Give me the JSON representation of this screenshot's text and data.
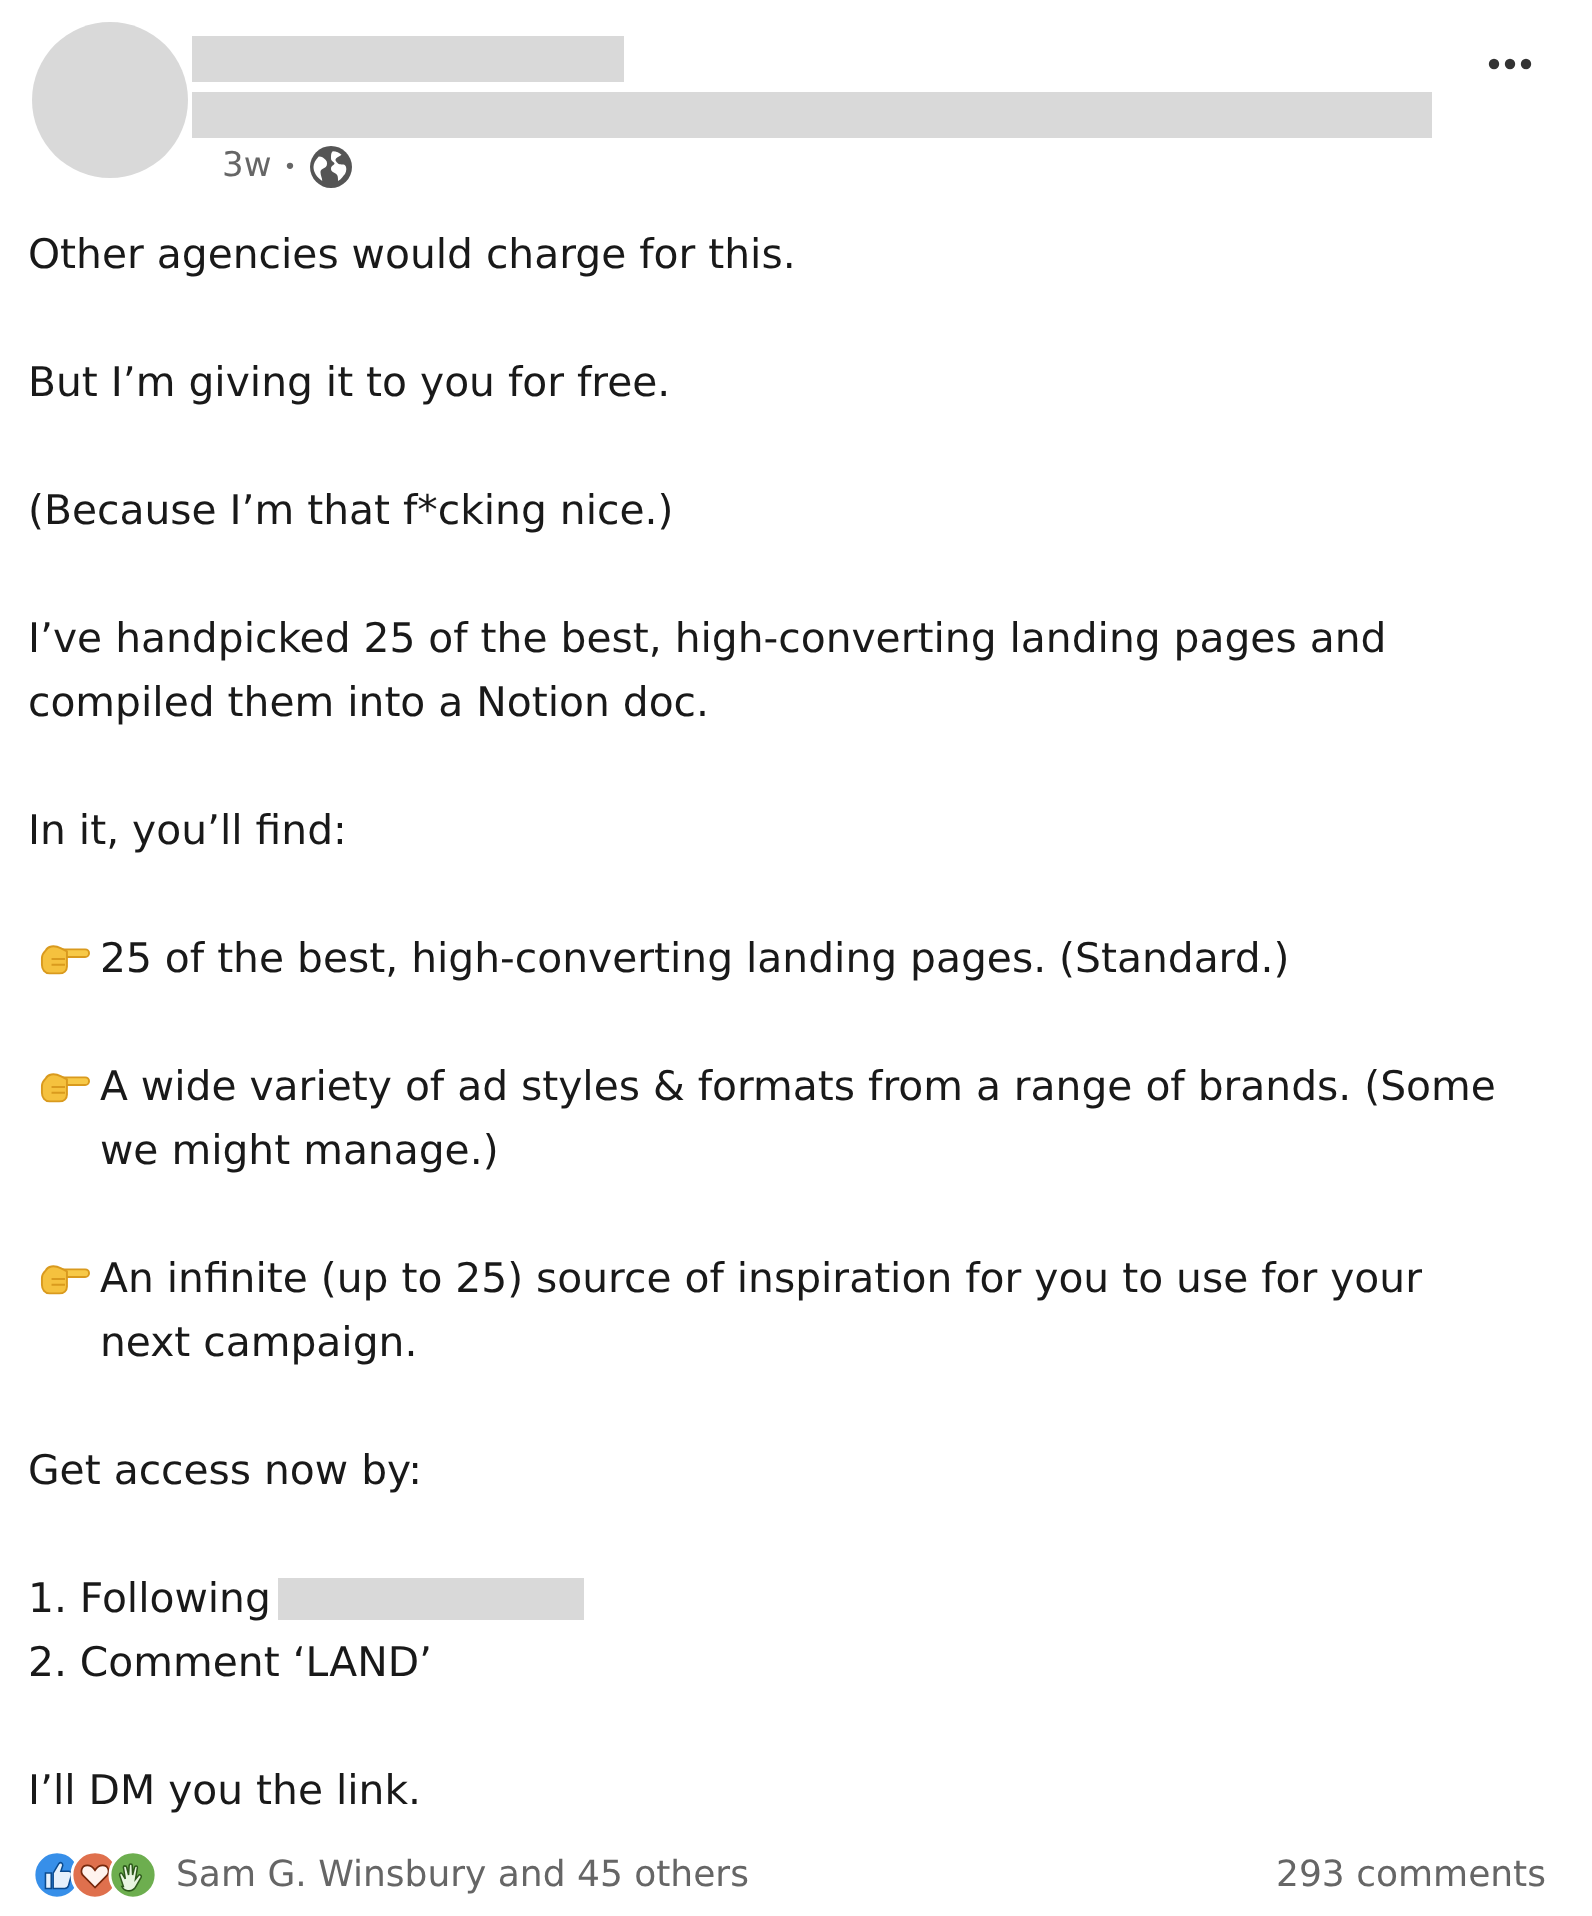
{
  "author": {
    "name_redacted": true,
    "headline_redacted": true
  },
  "post": {
    "time": "3w",
    "separator": "•"
  },
  "body": [
    {
      "kind": "text",
      "text": "Other agencies would charge for this."
    },
    {
      "kind": "text",
      "text": "But I’m giving it to you for free."
    },
    {
      "kind": "text",
      "text": "(Because I’m that f*cking nice.)"
    },
    {
      "kind": "text",
      "text": "I’ve handpicked 25 of the best, high-converting landing pages and compiled them into a Notion doc."
    },
    {
      "kind": "text",
      "text": "In it, you’ll find:"
    },
    {
      "kind": "point",
      "text": "25 of the best, high-converting landing pages. (Standard.)"
    },
    {
      "kind": "point",
      "text": "A wide variety of ad styles & formats from a range of brands. (Some we might manage.)"
    },
    {
      "kind": "point",
      "text": "An infinite (up to 25) source of inspiration for you to use for your next campaign."
    },
    {
      "kind": "text",
      "text": "Get access now by:"
    },
    {
      "kind": "list",
      "lines": [
        {
          "text": "1. Following",
          "redacted": true
        },
        {
          "text": "2. Comment ‘LAND’",
          "redacted": false
        }
      ]
    },
    {
      "kind": "text",
      "text": "I’ll DM you the link."
    }
  ],
  "footer": {
    "reactions": "Sam G. Winsbury and 45 others",
    "comments": "293 comments"
  }
}
